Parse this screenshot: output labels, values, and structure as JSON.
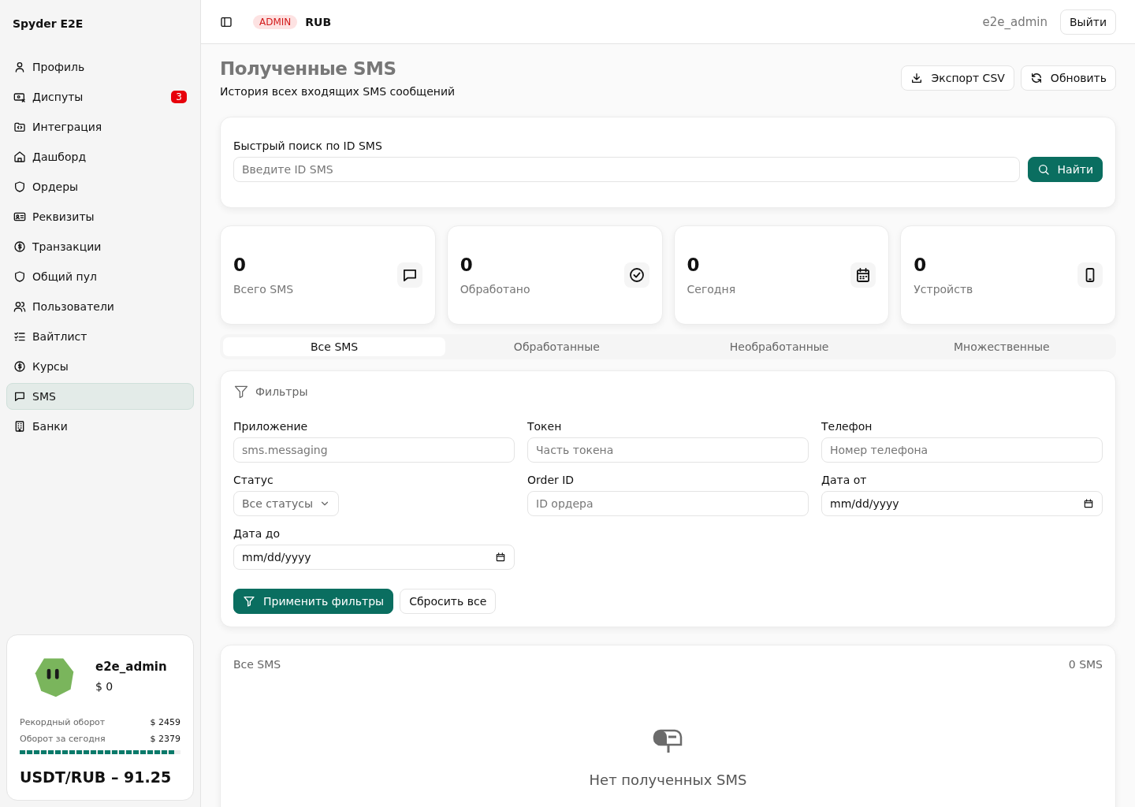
{
  "sidebar": {
    "brand": "Spyder E2E",
    "items": [
      {
        "label": "Профиль",
        "selected": false
      },
      {
        "label": "Диспуты",
        "selected": false,
        "badge": "3"
      },
      {
        "label": "Интеграция",
        "selected": false
      },
      {
        "label": "Дашборд",
        "selected": false
      },
      {
        "label": "Ордеры",
        "selected": false
      },
      {
        "label": "Реквизиты",
        "selected": false
      },
      {
        "label": "Транзакции",
        "selected": false
      },
      {
        "label": "Общий пул",
        "selected": false
      },
      {
        "label": "Пользователи",
        "selected": false
      },
      {
        "label": "Вайтлист",
        "selected": false
      },
      {
        "label": "Курсы",
        "selected": false
      },
      {
        "label": "SMS",
        "selected": true
      },
      {
        "label": "Банки",
        "selected": false
      }
    ],
    "profile": {
      "name": "e2e_admin",
      "balance": "$ 0",
      "stats": [
        {
          "label": "Рекордный оборот",
          "value": "$ 2459"
        },
        {
          "label": "Оборот за сегодня",
          "value": "$ 2379"
        }
      ],
      "level": 0.96,
      "rate": "USDT/RUB – 91.25"
    }
  },
  "header": {
    "role": "ADMIN",
    "currency": "RUB",
    "user": "e2e_admin",
    "logout": "Выйти"
  },
  "page": {
    "title": "Полученные SMS",
    "subtitle": "История всех входящих SMS сообщений",
    "actions": [
      "Экспорт CSV",
      "Обновить"
    ]
  },
  "search": {
    "label": "Быстрый поиск по ID SMS",
    "placeholder": "Введите ID SMS",
    "button": "Найти"
  },
  "stats": [
    {
      "value": "0",
      "label": "Всего SMS"
    },
    {
      "value": "0",
      "label": "Обработано"
    },
    {
      "value": "0",
      "label": "Сегодня"
    },
    {
      "value": "0",
      "label": "Устройств"
    }
  ],
  "tabs": [
    {
      "label": "Все SMS",
      "selected": true
    },
    {
      "label": "Обработанные",
      "selected": false
    },
    {
      "label": "Необработанные",
      "selected": false
    },
    {
      "label": "Множественные",
      "selected": false
    }
  ],
  "filters": {
    "title": "Фильтры",
    "fields": [
      {
        "kind": "text",
        "label": "Приложение",
        "placeholder": "sms.messaging"
      },
      {
        "kind": "text",
        "label": "Токен",
        "placeholder": "Часть токена"
      },
      {
        "kind": "text",
        "label": "Телефон",
        "placeholder": "Номер телефона"
      },
      {
        "kind": "select",
        "label": "Статус",
        "value": "Все статусы"
      },
      {
        "kind": "text",
        "label": "Order ID",
        "placeholder": "ID ордера"
      },
      {
        "kind": "date",
        "label": "Дата от",
        "value": "mm/dd/yyyy"
      },
      {
        "kind": "date",
        "label": "Дата до",
        "value": "mm/dd/yyyy"
      }
    ],
    "apply": "Применить фильтры",
    "reset": "Сбросить все"
  },
  "list": {
    "title": "Все SMS",
    "count": "0 SMS",
    "empty": "Нет полученных SMS"
  }
}
